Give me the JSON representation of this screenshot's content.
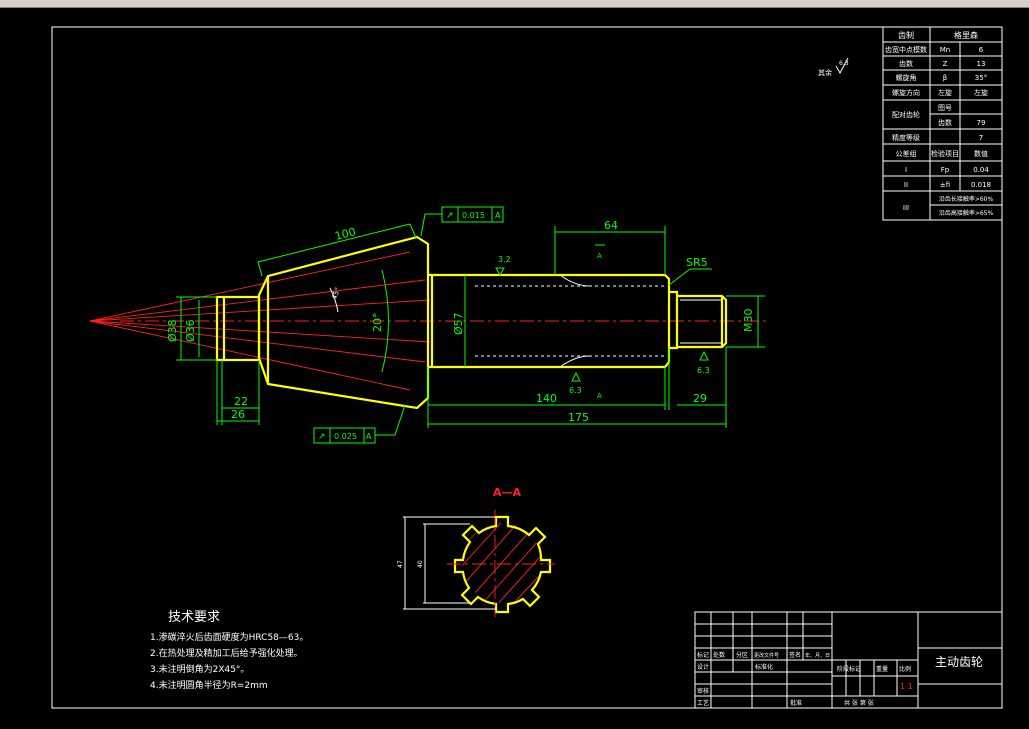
{
  "colors": {
    "background": "#000000",
    "outline": "#ffff00",
    "dimension": "#00ff00",
    "centerline": "#ff2020",
    "frame": "#ffffff"
  },
  "gear_table": {
    "rows": [
      [
        "齿制",
        "",
        "格里森"
      ],
      [
        "齿宽中点模数",
        "Mn",
        "6"
      ],
      [
        "齿数",
        "Z",
        "13"
      ],
      [
        "螺旋角",
        "β",
        "35°"
      ],
      [
        "螺旋方向",
        "左旋",
        "左旋"
      ],
      [
        "配对齿轮",
        "图号",
        ""
      ],
      [
        "",
        "齿数",
        "79"
      ],
      [
        "精度等级",
        "",
        "7"
      ],
      [
        "公差组",
        "检验项目",
        "数值"
      ],
      [
        "I",
        "Fp",
        "0.04"
      ],
      [
        "II",
        "±fi",
        "0.018"
      ],
      [
        "III",
        "沿齿长接触率>60%",
        ""
      ],
      [
        "",
        "沿齿高接触率>65%",
        ""
      ]
    ]
  },
  "roughness_note": {
    "label": "其余",
    "value": "6.3"
  },
  "dims": {
    "d100": "100",
    "d64": "64",
    "d140": "140",
    "d175": "175",
    "d29": "29",
    "d22": "22",
    "d26": "26",
    "d38": "Ø38",
    "d36": "Ø36",
    "d57": "Ø57",
    "m30": "M30",
    "sr5": "SR5",
    "angle20": "20°",
    "angle_small": "45°",
    "r1": "3.2",
    "r2": "6.3",
    "r3": "6.3",
    "sec_a": "A",
    "sec_a2": "A"
  },
  "tolerances": {
    "top": {
      "symbol": "↗",
      "value": "0.015",
      "datum": "A"
    },
    "bottom": {
      "symbol": "↗",
      "value": "0.025",
      "datum": "A"
    }
  },
  "section": {
    "title": "A—A",
    "dim1": "47",
    "dim2": "40"
  },
  "tech": {
    "title": "技术要求",
    "lines": [
      "1.渗碳淬火后齿面硬度为HRC58—63。",
      "2.在热处理及精加工后给予强化处理。",
      "3.未注明倒角为2X45°。",
      "4.未注明圆角半径为R=2mm"
    ]
  },
  "title_block": {
    "part_name": "主动齿轮",
    "labels": {
      "mark": "标记",
      "count": "处数",
      "zone": "分区",
      "docno": "更改文件号",
      "sign": "签名",
      "date": "年、月、日",
      "design": "设计",
      "std": "标准化",
      "review": "审核",
      "process": "工艺",
      "approve": "批准",
      "stage": "阶段标记",
      "weight": "重量",
      "scale": "比例",
      "sheet": "共 张 第 张"
    },
    "stage_marks": "1 1"
  }
}
